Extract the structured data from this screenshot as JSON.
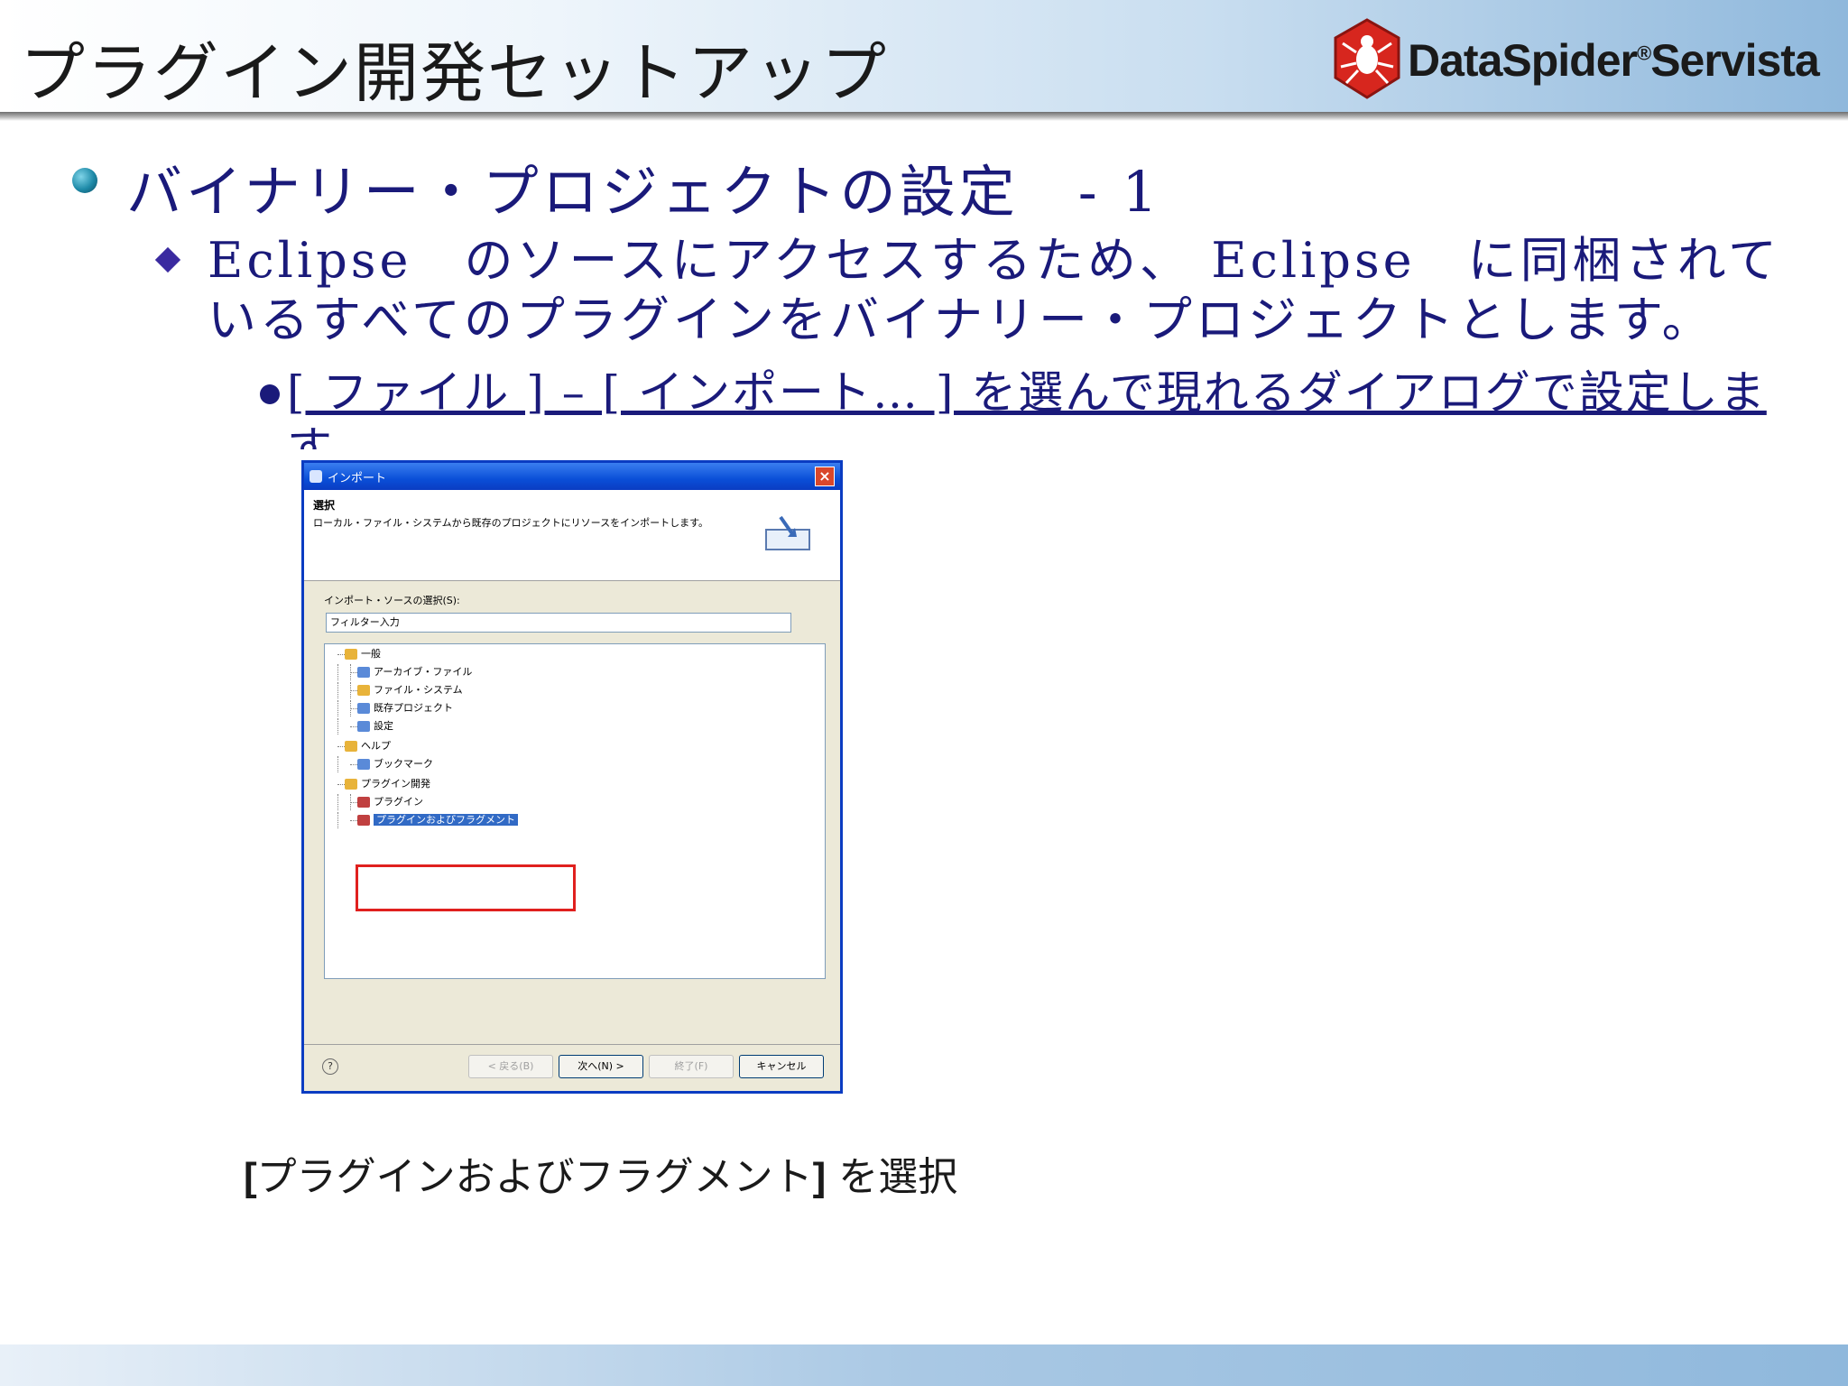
{
  "slide": {
    "title": "プラグイン開発セットアップ",
    "logo": {
      "brand": "DataSpider",
      "registered": "®",
      "product": "Servista"
    },
    "bullet1": "バイナリー・プロジェクトの設定　- 1",
    "bullet2": "Eclipse　のソースにアクセスするため、 Eclipse　に同梱されているすべてのプラグインをバイナリー・プロジェクトとします。",
    "bullet3": "[ ファイル ] – [ インポート… ] を選んで現れるダイアログで設定します。",
    "caption_open": "[",
    "caption_label": "プラグインおよびフラグメント",
    "caption_close": "]",
    "caption_rest": " を選択"
  },
  "colors": {
    "text_blue": "#1a1a7a",
    "highlight_red": "#e0201e",
    "dialog_titlebar": "#0a4fd8"
  },
  "dialog": {
    "title": "インポート",
    "heading": "選択",
    "description": "ローカル・ファイル・システムから既存のプロジェクトにリソースをインポートします。",
    "source_label": "インポート・ソースの選択(S):",
    "filter_value": "フィルター入力",
    "tree": [
      "一般",
      "アーカイブ・ファイル",
      "ファイル・システム",
      "既存プロジェクト",
      "設定",
      "ヘルプ",
      "ブックマーク",
      "プラグイン開発",
      "プラグイン",
      "プラグインおよびフラグメント"
    ],
    "buttons": {
      "back": "< 戻る(B)",
      "next": "次へ(N) >",
      "finish": "終了(F)",
      "cancel": "キャンセル"
    },
    "help_icon": "help-icon",
    "wizard_icon": "import-wizard-icon"
  }
}
